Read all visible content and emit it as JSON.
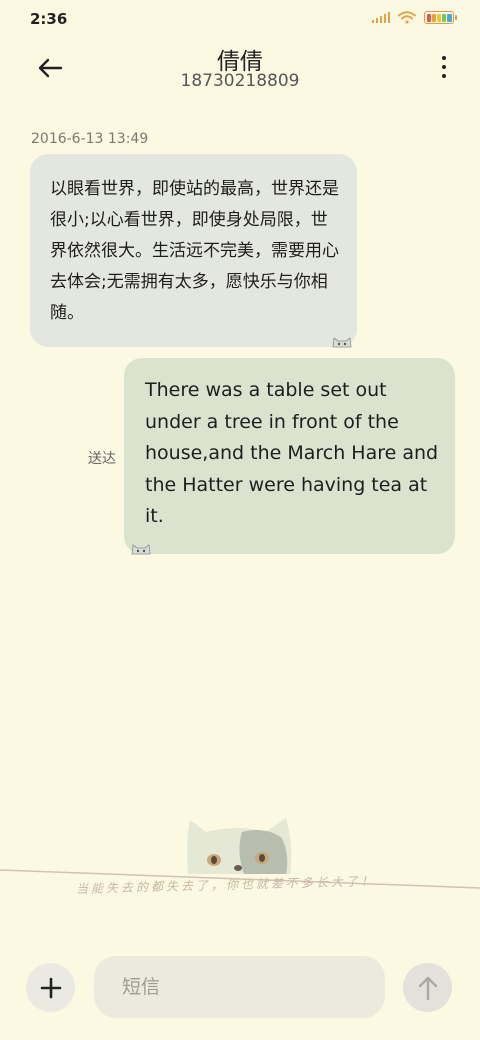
{
  "status_bar": {
    "time": "2:36",
    "signal_color": "#e5a04a",
    "battery_colors": [
      "#e05a4a",
      "#e8a040",
      "#e8c840",
      "#7cc25a",
      "#4aa8d8"
    ]
  },
  "header": {
    "contact_name": "倩倩",
    "contact_number": "18730218809",
    "back_icon": "arrow-left-icon",
    "more_icon": "more-vertical-icon"
  },
  "conversation": {
    "timestamp": "2016-6-13 13:49",
    "messages": [
      {
        "direction": "incoming",
        "text": "以眼看世界，即使站的最高，世界还是很小;以心看世界，即使身处局限，世界依然很大。生活远不完美，需要用心去体会;无需拥有太多，愿快乐与你相随。"
      },
      {
        "direction": "outgoing",
        "status": "送达",
        "text": "There was a table set out under a tree in front of the house,and the March Hare and the Hatter were having tea at it."
      }
    ]
  },
  "decoration": {
    "caption": "当能失去的都失去了，你也就差不多长大了！"
  },
  "compose": {
    "add_icon": "plus-icon",
    "placeholder": "短信",
    "send_icon": "arrow-up-icon"
  },
  "colors": {
    "background": "#fcf9e3",
    "incoming_bubble": "#e4e7e0",
    "outgoing_bubble": "#dbe3cf"
  }
}
